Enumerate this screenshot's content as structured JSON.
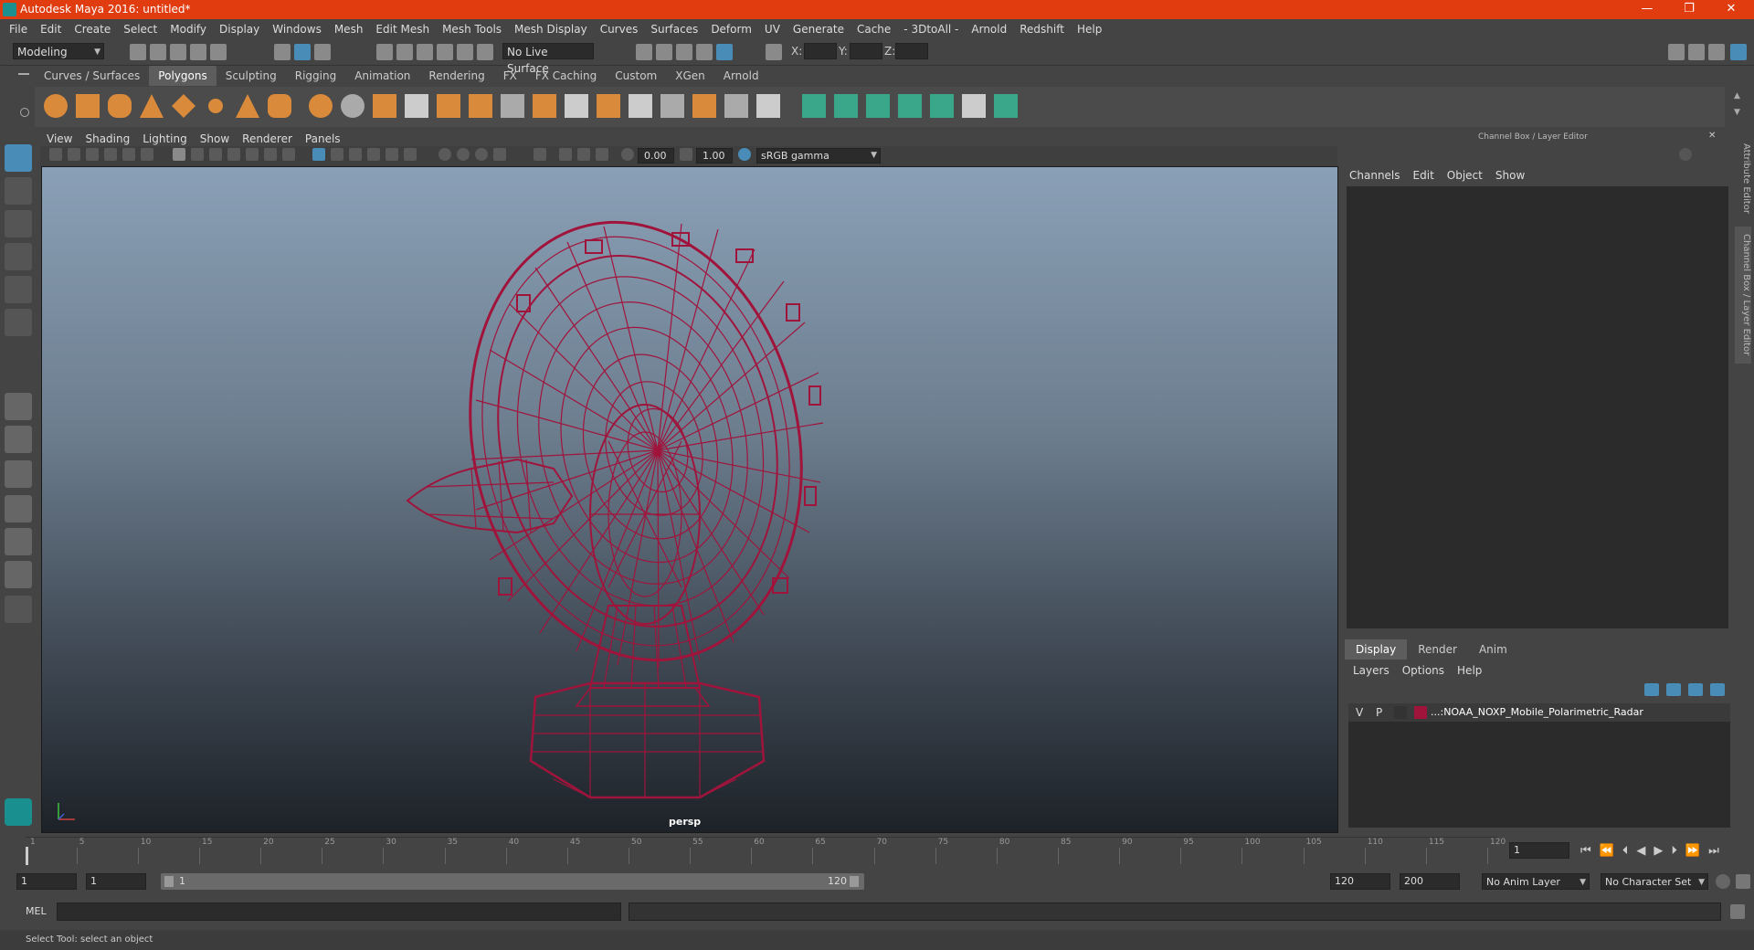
{
  "window": {
    "title": "Autodesk Maya 2016: untitled*",
    "minimize": "—",
    "maximize": "❐",
    "close": "✕"
  },
  "menubar": [
    "File",
    "Edit",
    "Create",
    "Select",
    "Modify",
    "Display",
    "Windows",
    "Mesh",
    "Edit Mesh",
    "Mesh Tools",
    "Mesh Display",
    "Curves",
    "Surfaces",
    "Deform",
    "UV",
    "Generate",
    "Cache",
    "- 3DtoAll -",
    "Arnold",
    "Redshift",
    "Help"
  ],
  "statusline": {
    "mode": "Modeling",
    "live_surface": "No Live Surface",
    "x_label": "X:",
    "y_label": "Y:",
    "z_label": "Z:"
  },
  "shelf": {
    "tabs": [
      "Curves / Surfaces",
      "Polygons",
      "Sculpting",
      "Rigging",
      "Animation",
      "Rendering",
      "FX",
      "FX Caching",
      "Custom",
      "XGen",
      "Arnold"
    ],
    "active_tab": "Polygons"
  },
  "viewport": {
    "menu": [
      "View",
      "Shading",
      "Lighting",
      "Show",
      "Renderer",
      "Panels"
    ],
    "exposure": "0.00",
    "gamma": "1.00",
    "colorspace": "sRGB gamma",
    "camera_label": "persp"
  },
  "channel_box": {
    "title": "Channel Box / Layer Editor",
    "menu": [
      "Channels",
      "Edit",
      "Object",
      "Show"
    ]
  },
  "layer_editor": {
    "tabs": [
      "Display",
      "Render",
      "Anim"
    ],
    "active_tab": "Display",
    "menu": [
      "Layers",
      "Options",
      "Help"
    ],
    "layer": {
      "v": "V",
      "p": "P",
      "name": "...:NOAA_NOXP_Mobile_Polarimetric_Radar",
      "color": "#a0143c"
    }
  },
  "side_tabs": {
    "attribute_editor": "Attribute Editor",
    "channel_box": "Channel Box / Layer Editor"
  },
  "timeline": {
    "ticks": [
      "1",
      "5",
      "10",
      "15",
      "20",
      "25",
      "30",
      "35",
      "40",
      "45",
      "50",
      "55",
      "60",
      "65",
      "70",
      "75",
      "80",
      "85",
      "90",
      "95",
      "100",
      "105",
      "110",
      "115",
      "120"
    ],
    "current_frame": "1"
  },
  "range": {
    "start": "1",
    "playback_start": "1",
    "slider_start": "1",
    "slider_end": "120",
    "playback_end": "120",
    "end": "200",
    "anim_layer": "No Anim Layer",
    "character_set": "No Character Set"
  },
  "cmdline": {
    "label": "MEL"
  },
  "helpline": {
    "text": "Select Tool: select an object"
  },
  "colors": {
    "title_bar": "#e03c10",
    "wireframe": "#a0143c",
    "accent": "#4a8cb8"
  }
}
